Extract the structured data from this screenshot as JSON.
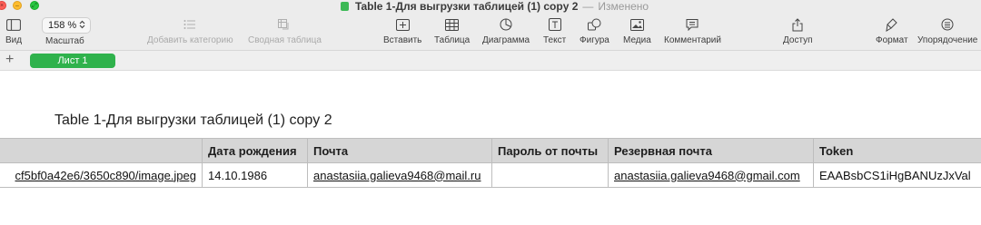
{
  "window": {
    "title": "Table 1-Для выгрузки таблицей (1) copy 2",
    "separator": "—",
    "status": "Изменено"
  },
  "toolbar": {
    "view_label": "Вид",
    "zoom_value": "158 %",
    "zoom_label": "Масштаб",
    "add_category_label": "Добавить категорию",
    "pivot_label": "Сводная таблица",
    "insert_label": "Вставить",
    "table_label": "Таблица",
    "chart_label": "Диаграмма",
    "text_label": "Текст",
    "shape_label": "Фигура",
    "media_label": "Медиа",
    "comment_label": "Комментарий",
    "share_label": "Доступ",
    "format_label": "Формат",
    "arrange_label": "Упорядочение"
  },
  "sheets": {
    "add": "+",
    "active_tab": "Лист 1"
  },
  "table": {
    "title": "Table 1-Для выгрузки таблицей (1) copy 2",
    "headers": [
      "",
      "Дата рождения",
      "Почта",
      "Пароль от почты",
      "Резервная почта",
      "Token"
    ],
    "rows": [
      [
        "cf5bf0a42e6/3650c890/image.jpeg",
        "14.10.1986",
        "anastasiia.galieva9468@mail.ru",
        "",
        "anastasiia.galieva9468@gmail.com",
        "EAABsbCS1iHgBANUzJxVal"
      ]
    ]
  },
  "colors": {
    "accent_green": "#2fb24c",
    "header_bg": "#d6d6d6",
    "toolbar_bg": "#ececec"
  },
  "icons": [
    "sidebar-view-icon",
    "chevron-updown-icon",
    "add-category-icon",
    "pivot-table-icon",
    "insert-icon",
    "table-icon",
    "chart-icon",
    "text-icon",
    "shape-icon",
    "media-icon",
    "comment-icon",
    "share-icon",
    "format-brush-icon",
    "arrange-icon"
  ]
}
